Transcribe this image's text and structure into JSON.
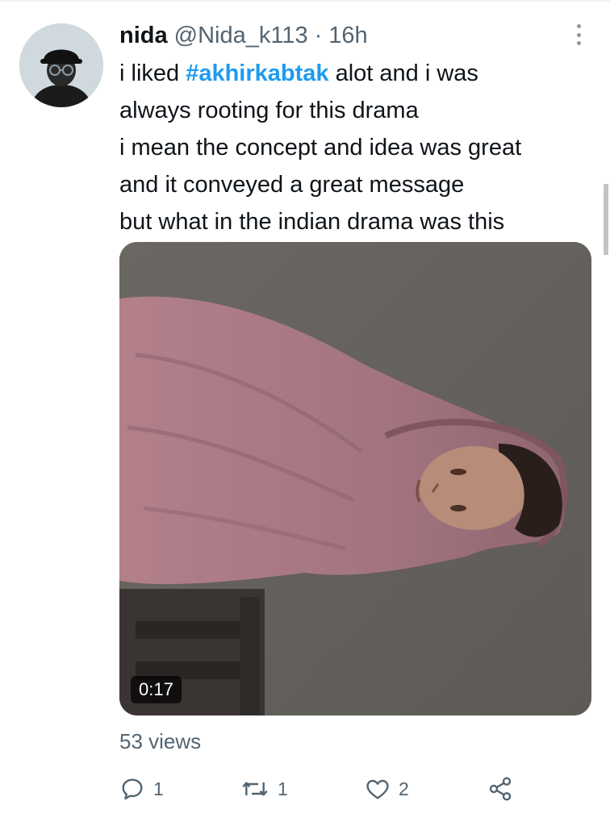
{
  "tweet": {
    "display_name": "nida",
    "handle": "@Nida_k113",
    "separator": "·",
    "time": "16h",
    "text_lines": [
      {
        "before": "i liked ",
        "hashtag": "#akhirkabtak",
        "after": " alot and i was"
      },
      {
        "text": "always rooting for this drama"
      },
      {
        "text": "i mean the concept and idea was great"
      },
      {
        "text": "and it conveyed a great message"
      },
      {
        "text": "but what in the indian drama was this"
      }
    ],
    "media": {
      "type": "video",
      "duration": "0:17"
    },
    "views_label": "53 views",
    "actions": {
      "reply_count": "1",
      "retweet_count": "1",
      "like_count": "2"
    }
  },
  "icons": {
    "reply": "reply-icon",
    "retweet": "retweet-icon",
    "like": "heart-icon",
    "share": "share-icon",
    "more": "more-options-icon"
  },
  "colors": {
    "link": "#1d9bf0",
    "secondary_text": "#536471",
    "primary_text": "#0f1419"
  }
}
